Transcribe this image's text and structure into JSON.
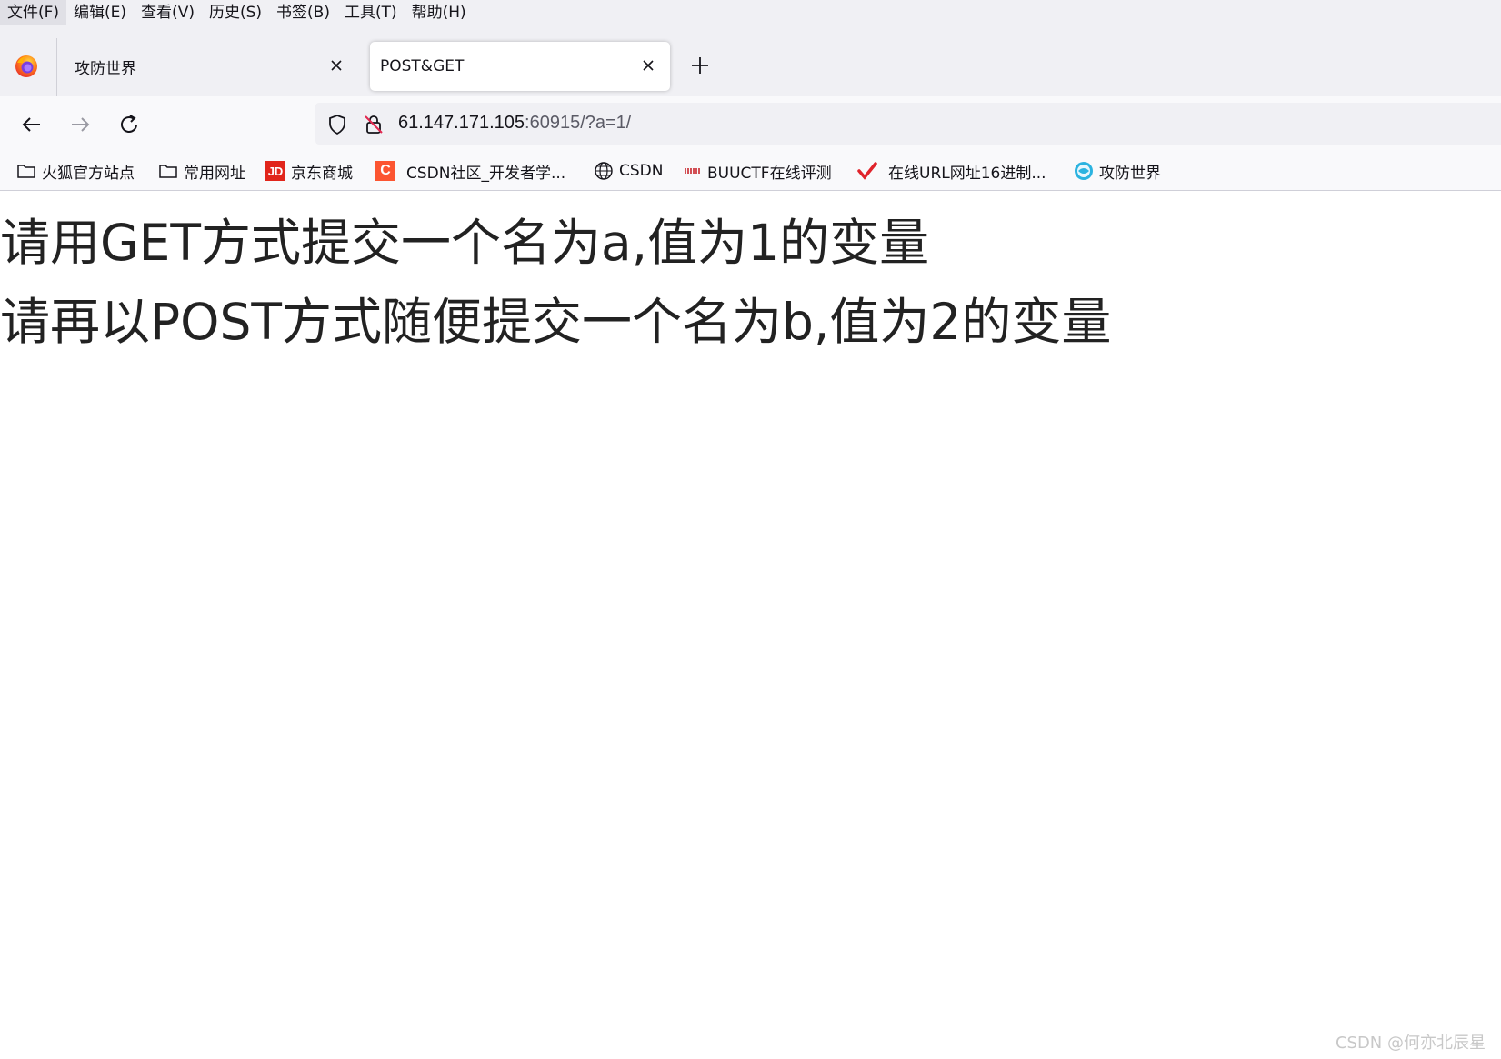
{
  "menubar": {
    "items": [
      "文件(F)",
      "编辑(E)",
      "查看(V)",
      "历史(S)",
      "书签(B)",
      "工具(T)",
      "帮助(H)"
    ]
  },
  "tabs": [
    {
      "label": "攻防世界",
      "active": false
    },
    {
      "label": "POST&GET",
      "active": true
    }
  ],
  "urlbar": {
    "host": "61.147.171.105",
    "rest": ":60915/?a=1/"
  },
  "bookmarks": [
    {
      "label": "火狐官方站点",
      "icon": "folder-icon"
    },
    {
      "label": "常用网址",
      "icon": "folder-icon"
    },
    {
      "label": "京东商城",
      "icon": "jd-icon",
      "icon_text": "JD"
    },
    {
      "label": "CSDN社区_开发者学...",
      "icon": "csdn-icon",
      "icon_text": "C"
    },
    {
      "label": "CSDN",
      "icon": "globe-icon"
    },
    {
      "label": "BUUCTF在线评测",
      "icon": "buuctf-icon"
    },
    {
      "label": "在线URL网址16进制...",
      "icon": "checkmark-icon"
    },
    {
      "label": "攻防世界",
      "icon": "adworld-icon"
    }
  ],
  "content": {
    "line1": "请用GET方式提交一个名为a,值为1的变量",
    "line2": "请再以POST方式随便提交一个名为b,值为2的变量"
  },
  "watermark": "CSDN @何亦北辰星",
  "colors": {
    "chrome_bg": "#f0f0f4",
    "toolbar_bg": "#f9f9fb",
    "text": "#15141a",
    "content_text": "#222222",
    "jd_red": "#e1251b",
    "csdn_orange": "#fc5531",
    "check_red": "#e0232b"
  }
}
